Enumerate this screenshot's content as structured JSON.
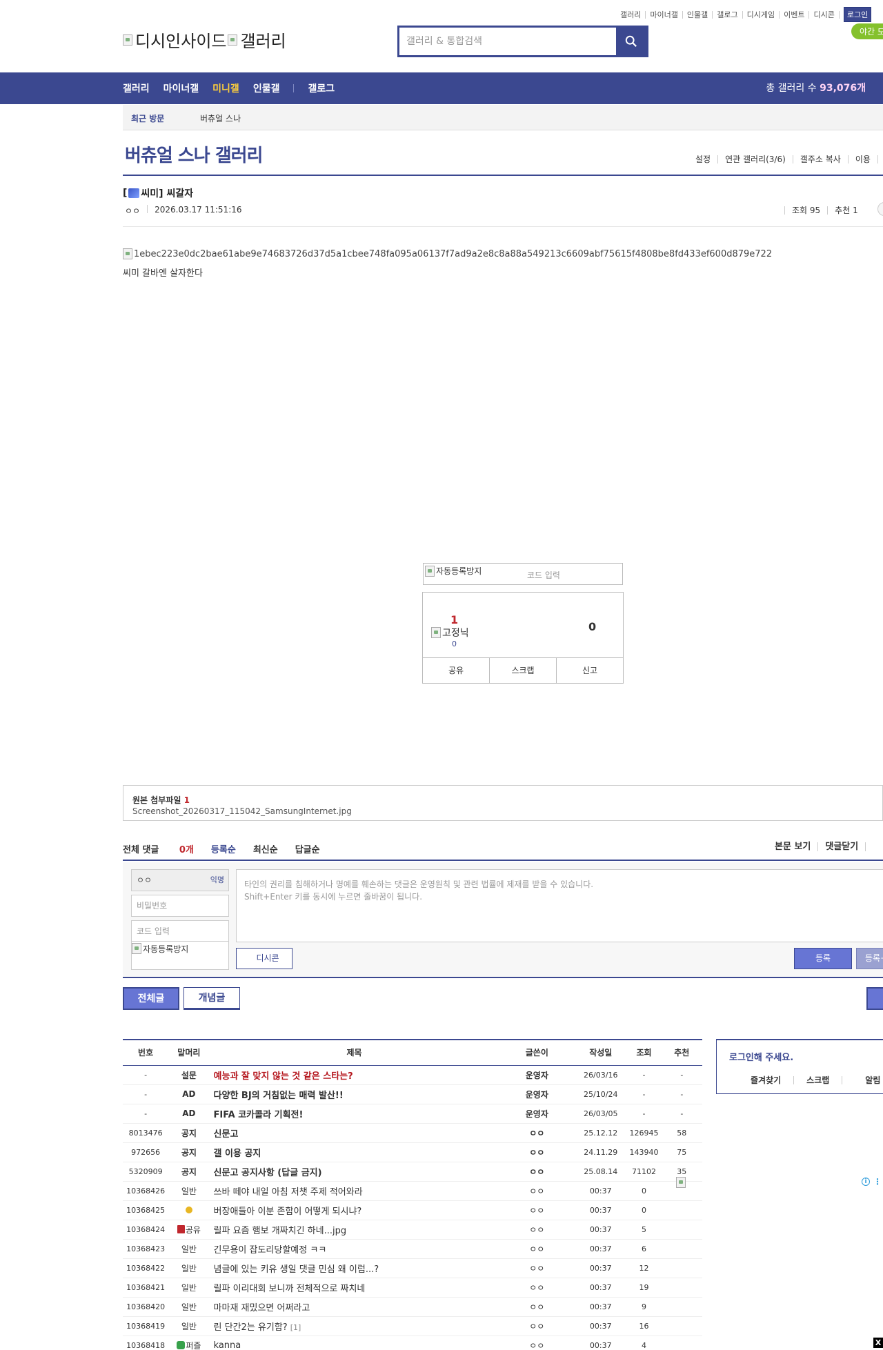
{
  "topnav": {
    "items": [
      "갤러리",
      "마이너갤",
      "인물갤",
      "갤로그",
      "디시게임",
      "이벤트",
      "디시콘"
    ],
    "login": "로그인",
    "night_mode": "야간 모"
  },
  "logo": {
    "alt1": "디시인사이드",
    "alt2": "갤러리"
  },
  "search": {
    "placeholder": "갤러리 & 통합검색"
  },
  "gnb": {
    "menu": [
      "갤러리",
      "마이너갤",
      "미니갤",
      "인물갤",
      "갤로그"
    ],
    "count_label": "총 갤러리 수 ",
    "count_value": "93,076개"
  },
  "visit": {
    "label": "최근 방문",
    "recent": "버츄얼 스나"
  },
  "gallery": {
    "title": "버츄얼 스나 갤러리",
    "tools": [
      "설정",
      "연관 갤러리(3/6)",
      "갤주소 복사",
      "이용"
    ]
  },
  "post": {
    "title_prefix": "[",
    "title_rest": "씨미] 씨갈자",
    "author": "ㅇㅇ",
    "datetime": "2026.03.17 11:51:16",
    "views": "조회 95",
    "recommend": "추천 1",
    "image_alt": "1ebec223e0dc2bae61abe9e74683726d37d5a1cbee748fa095a06137f7ad9a2e8c8a88a549213c6609abf75615f4808be8fd433ef600d879e722",
    "body": "씨미 갈바엔 살자한다"
  },
  "captcha": {
    "img_alt": "자동등록방지",
    "input_placeholder": "코드 입력"
  },
  "recommend_box": {
    "up": "1",
    "fixed_alt": "고정닉",
    "fixed_count": "0",
    "down": "0",
    "share": "공유",
    "scrap": "스크랩",
    "report": "신고"
  },
  "attachment": {
    "label": "원본 첨부파일 ",
    "count": "1",
    "filename": "Screenshot_20260317_115042_SamsungInternet.jpg"
  },
  "comments": {
    "total_label": "전체 댓글 ",
    "total_count": "0개",
    "sort": [
      "등록순",
      "최신순",
      "답글순"
    ],
    "right": [
      "본문 보기",
      "댓글닫기"
    ]
  },
  "comment_form": {
    "nick": "ㅇㅇ",
    "anon": "익명",
    "password_placeholder": "비밀번호",
    "code_placeholder": "코드 입력",
    "captcha_alt": "자동등록방지",
    "textarea_line1": "타인의 권리를 침해하거나 명예를 훼손하는 댓글은 운영원칙 및 관련 법률에 제재를 받을 수 있습니다.",
    "textarea_line2": "Shift+Enter 키를 동시에 누르면 줄바꿈이 됩니다.",
    "dccon": "디시콘",
    "submit": "등록",
    "submit2": "등록+"
  },
  "tabs": {
    "all": "전체글",
    "concept": "개념글"
  },
  "list": {
    "headers": [
      "번호",
      "말머리",
      "제목",
      "글쓴이",
      "작성일",
      "조회",
      "추천"
    ],
    "notices": [
      {
        "no": "-",
        "head": "설문",
        "subject": "예능과 잘 맞지 않는 것 같은 스타는?",
        "writer": "운영자",
        "date": "26/03/16",
        "views": "-",
        "rec": "-",
        "red": true
      },
      {
        "no": "-",
        "head": "AD",
        "subject": "다양한 BJ의 거침없는 매력 발산!!",
        "writer": "운영자",
        "date": "25/10/24",
        "views": "-",
        "rec": "-"
      },
      {
        "no": "-",
        "head": "AD",
        "subject": "FIFA 코카콜라 기획전!",
        "writer": "운영자",
        "date": "26/03/05",
        "views": "-",
        "rec": "-"
      },
      {
        "no": "8013476",
        "head": "공지",
        "subject": "신문고",
        "writer": "ㅇㅇ",
        "date": "25.12.12",
        "views": "126945",
        "rec": "58"
      },
      {
        "no": "972656",
        "head": "공지",
        "subject": "갤 이용 공지",
        "writer": "ㅇㅇ",
        "date": "24.11.29",
        "views": "143940",
        "rec": "75"
      },
      {
        "no": "5320909",
        "head": "공지",
        "subject": "신문고 공지사항 (답글 금지)",
        "writer": "ㅇㅇ",
        "date": "25.08.14",
        "views": "71102",
        "rec": "35"
      }
    ],
    "rows": [
      {
        "no": "10368426",
        "head": "일반",
        "subject": "쓰바 떼야 내일 아침 저챗 주제 적어와라",
        "writer": "ㅇㅇ",
        "date": "00:37",
        "views": "0",
        "rec": ""
      },
      {
        "no": "10368425",
        "head": "",
        "icon": "face",
        "subject": "버장애들아 이분 존함이 어떻게 되시냐?",
        "writer": "ㅇㅇ",
        "date": "00:37",
        "views": "0",
        "rec": ""
      },
      {
        "no": "10368424",
        "head": "공유",
        "icon": "red",
        "subject": "릴파 요즘 햄보 개짜치긴 하네...jpg",
        "writer": "ㅇㅇ",
        "date": "00:37",
        "views": "5",
        "rec": ""
      },
      {
        "no": "10368423",
        "head": "일반",
        "subject": "긴무용이 잡도리당할예정 ㅋㅋ",
        "writer": "ㅇㅇ",
        "date": "00:37",
        "views": "6",
        "rec": ""
      },
      {
        "no": "10368422",
        "head": "일반",
        "subject": "념글에 있는 키유 생일 댓글 민심 왜 이럼...?",
        "writer": "ㅇㅇ",
        "date": "00:37",
        "views": "12",
        "rec": ""
      },
      {
        "no": "10368421",
        "head": "일반",
        "subject": "릴파 이리대회 보니까 전체적으로 짜치네",
        "writer": "ㅇㅇ",
        "date": "00:37",
        "views": "19",
        "rec": ""
      },
      {
        "no": "10368420",
        "head": "일반",
        "subject": "마마재 재밌으면 어쩌라고",
        "writer": "ㅇㅇ",
        "date": "00:37",
        "views": "9",
        "rec": ""
      },
      {
        "no": "10368419",
        "head": "일반",
        "subject": "린 단간2는 유기함?",
        "reply": "[1]",
        "writer": "ㅇㅇ",
        "date": "00:37",
        "views": "16",
        "rec": ""
      },
      {
        "no": "10368418",
        "head": "퍼즐",
        "icon": "puzzle",
        "subject": "kanna",
        "writer": "ㅇㅇ",
        "date": "00:37",
        "views": "4",
        "rec": ""
      }
    ]
  },
  "login_box": {
    "message": "로그인해 주세요.",
    "links": [
      "즐겨찾기",
      "스크랩",
      "알림"
    ]
  },
  "ad": {
    "info": "i",
    "close": "X"
  }
}
